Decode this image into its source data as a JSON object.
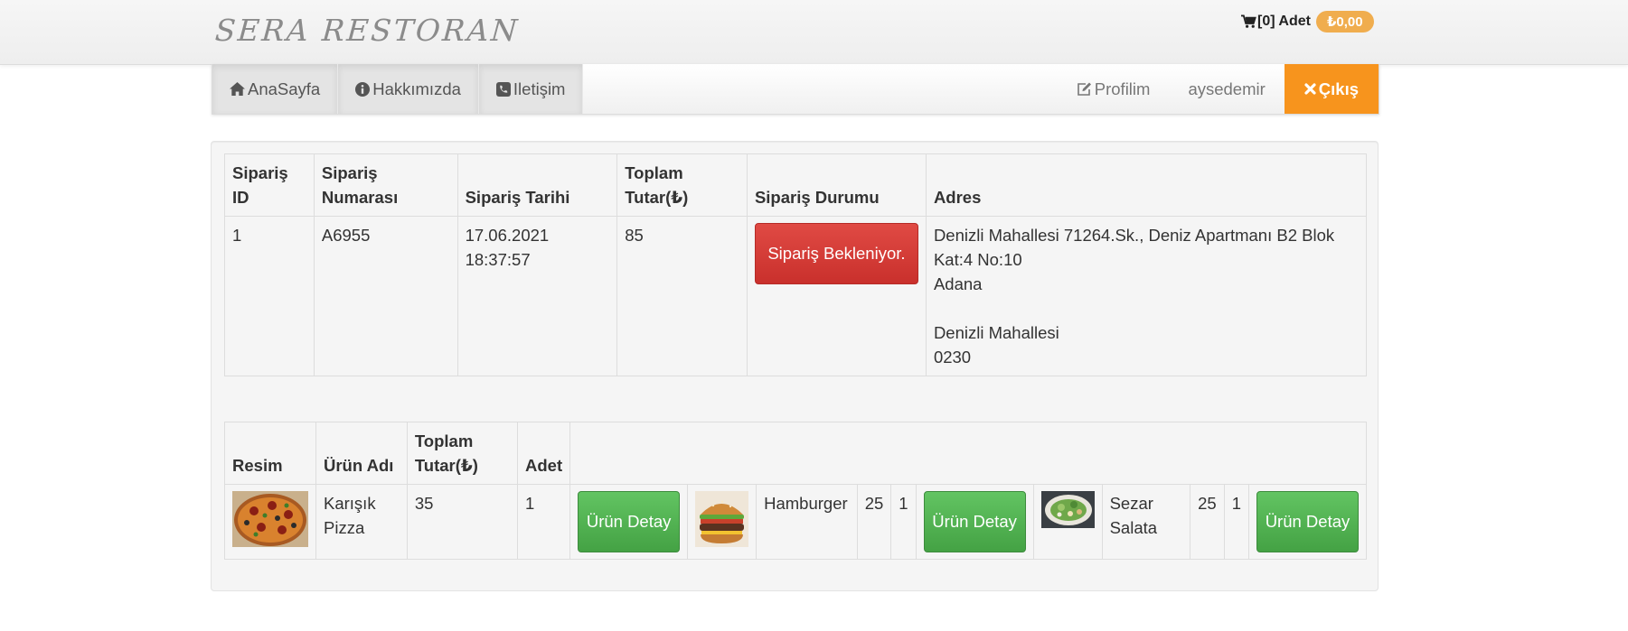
{
  "header": {
    "brand": "SERA RESTORAN",
    "cart_label": "[0] Adet",
    "cart_total": "₺0,00"
  },
  "nav": {
    "home": "AnaSayfa",
    "about": "Hakkımızda",
    "contact": "Iletişim",
    "profile": "Profilim",
    "username": "aysedemir",
    "logout": "Çıkış"
  },
  "order_table": {
    "headers": [
      "Sipariş ID",
      "Sipariş Numarası",
      "Sipariş Tarihi",
      "Toplam Tutar(₺)",
      "Sipariş Durumu",
      "Adres"
    ],
    "row": {
      "id": "1",
      "number": "A6955",
      "date": "17.06.2021\n18:37:57",
      "total": "85",
      "status": "Sipariş Bekleniyor.",
      "address": "Denizli Mahallesi 71264.Sk., Deniz Apartmanı B2 Blok\nKat:4 No:10\nAdana\n\nDenizli Mahallesi\n0230"
    }
  },
  "items_table": {
    "headers": [
      "Resim",
      "Ürün Adı",
      "Toplam Tutar(₺)",
      "Adet"
    ],
    "items": [
      {
        "name": "Karışık Pizza",
        "total": "35",
        "qty": "1",
        "button": "Ürün Detay",
        "image": "pizza-image"
      },
      {
        "name": "Hamburger",
        "total": "25",
        "qty": "1",
        "button": "Ürün Detay",
        "image": "hamburger-image"
      },
      {
        "name": "Sezar Salata",
        "total": "25",
        "qty": "1",
        "button": "Ürün Detay",
        "image": "salad-image"
      }
    ]
  },
  "colors": {
    "accent_orange": "#f7941d",
    "badge_orange": "#f0ad4e",
    "danger": "#d9534f",
    "success": "#5cb85c"
  }
}
